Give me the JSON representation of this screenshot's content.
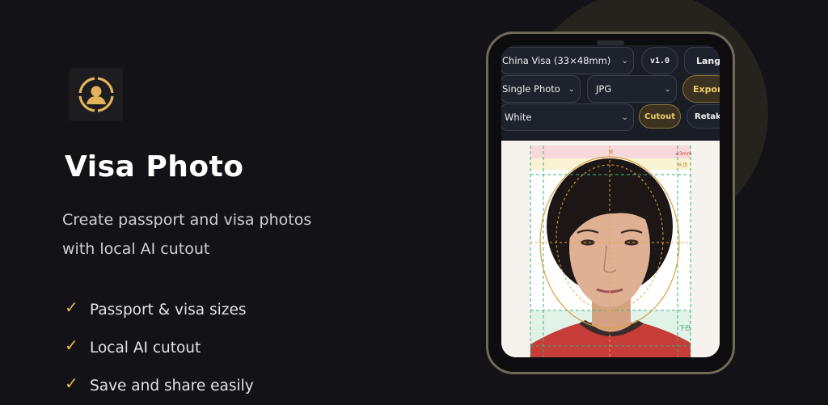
{
  "app": {
    "icon": "person-portrait-icon",
    "title": "Visa Photo",
    "subtitle_lines": [
      "Create passport and visa photos",
      "with local AI cutout"
    ]
  },
  "features": [
    {
      "check": "✓",
      "label": "Passport & visa sizes"
    },
    {
      "check": "✓",
      "label": "Local AI cutout"
    },
    {
      "check": "✓",
      "label": "Save and share easily"
    }
  ],
  "phone": {
    "size_select": "China Visa (33×48mm)",
    "version": "v1.0",
    "lang_button": "Lang",
    "layout_select": "Single Photo",
    "format_select": "JPG",
    "export_button": "Export",
    "background_select": "White",
    "cutout_button": "Cutout",
    "retake_button": "Retake",
    "guide_labels": {
      "top": "顶",
      "crown": "≤3mm",
      "head": "头顶",
      "chin": "下巴"
    }
  },
  "colors": {
    "accent_gold": "#e9b64c",
    "background": "#131317",
    "phone_frame": "#6e6a55"
  }
}
